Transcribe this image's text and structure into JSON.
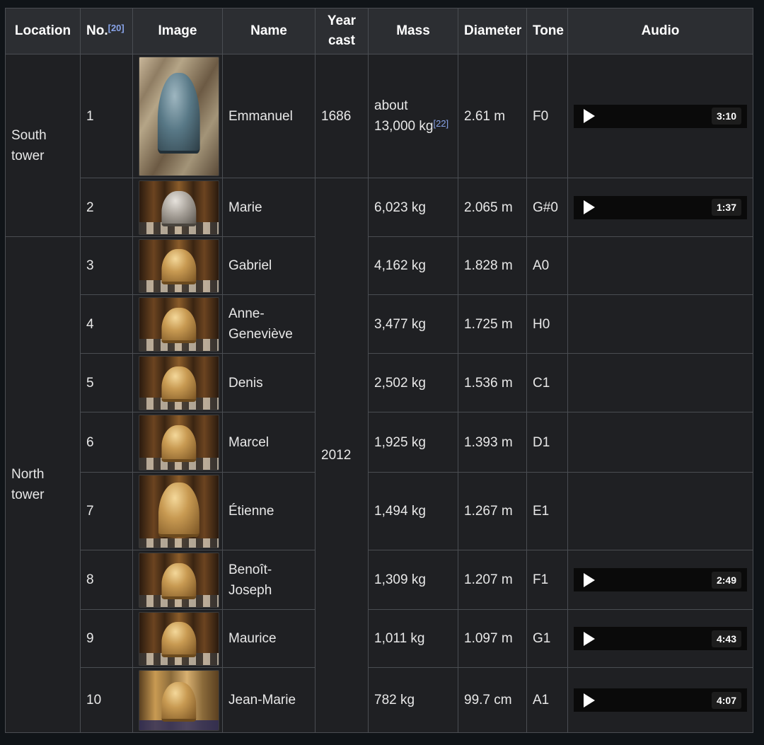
{
  "headers": {
    "location": "Location",
    "no": "No.",
    "no_ref": "[20]",
    "image": "Image",
    "name": "Name",
    "year_line1": "Year",
    "year_line2": "cast",
    "mass": "Mass",
    "diameter": "Diameter",
    "tone": "Tone",
    "audio": "Audio"
  },
  "locations": {
    "south_line1": "South",
    "south_line2": "tower",
    "north_line1": "North",
    "north_line2": "tower"
  },
  "years": {
    "emmanuel": "1686",
    "rest": "2012"
  },
  "rows": [
    {
      "no": "1",
      "name_line1": "Emmanuel",
      "name_line2": "",
      "mass_line1": "about",
      "mass_line2": "13,000 kg",
      "mass_ref": "[22]",
      "diameter": "2.61 m",
      "tone": "F0",
      "duration": "3:10"
    },
    {
      "no": "2",
      "name_line1": "Marie",
      "name_line2": "",
      "mass_line1": "6,023 kg",
      "mass_line2": "",
      "mass_ref": "",
      "diameter": "2.065 m",
      "tone": "G#0",
      "duration": "1:37"
    },
    {
      "no": "3",
      "name_line1": "Gabriel",
      "name_line2": "",
      "mass_line1": "4,162 kg",
      "mass_line2": "",
      "mass_ref": "",
      "diameter": "1.828 m",
      "tone": "A0",
      "duration": ""
    },
    {
      "no": "4",
      "name_line1": "Anne-",
      "name_line2": "Geneviève",
      "mass_line1": "3,477 kg",
      "mass_line2": "",
      "mass_ref": "",
      "diameter": "1.725 m",
      "tone": "H0",
      "duration": ""
    },
    {
      "no": "5",
      "name_line1": "Denis",
      "name_line2": "",
      "mass_line1": "2,502 kg",
      "mass_line2": "",
      "mass_ref": "",
      "diameter": "1.536 m",
      "tone": "C1",
      "duration": ""
    },
    {
      "no": "6",
      "name_line1": "Marcel",
      "name_line2": "",
      "mass_line1": "1,925 kg",
      "mass_line2": "",
      "mass_ref": "",
      "diameter": "1.393 m",
      "tone": "D1",
      "duration": ""
    },
    {
      "no": "7",
      "name_line1": "Étienne",
      "name_line2": "",
      "mass_line1": "1,494 kg",
      "mass_line2": "",
      "mass_ref": "",
      "diameter": "1.267 m",
      "tone": "E1",
      "duration": ""
    },
    {
      "no": "8",
      "name_line1": "Benoît-",
      "name_line2": "Joseph",
      "mass_line1": "1,309 kg",
      "mass_line2": "",
      "mass_ref": "",
      "diameter": "1.207 m",
      "tone": "F1",
      "duration": "2:49"
    },
    {
      "no": "9",
      "name_line1": "Maurice",
      "name_line2": "",
      "mass_line1": "1,011 kg",
      "mass_line2": "",
      "mass_ref": "",
      "diameter": "1.097 m",
      "tone": "G1",
      "duration": "4:43"
    },
    {
      "no": "10",
      "name_line1": "Jean-Marie",
      "name_line2": "",
      "mass_line1": "782 kg",
      "mass_line2": "",
      "mass_ref": "",
      "diameter": "99.7 cm",
      "tone": "A1",
      "duration": "4:07"
    }
  ],
  "icons": {
    "play": "play-icon",
    "bell_photo": "bell-photo"
  },
  "colors": {
    "background": "#101418",
    "header_bg": "#2c2e32",
    "cell_bg": "#1f2023",
    "border": "#4a4d52",
    "ref_link": "#88a3e8"
  }
}
